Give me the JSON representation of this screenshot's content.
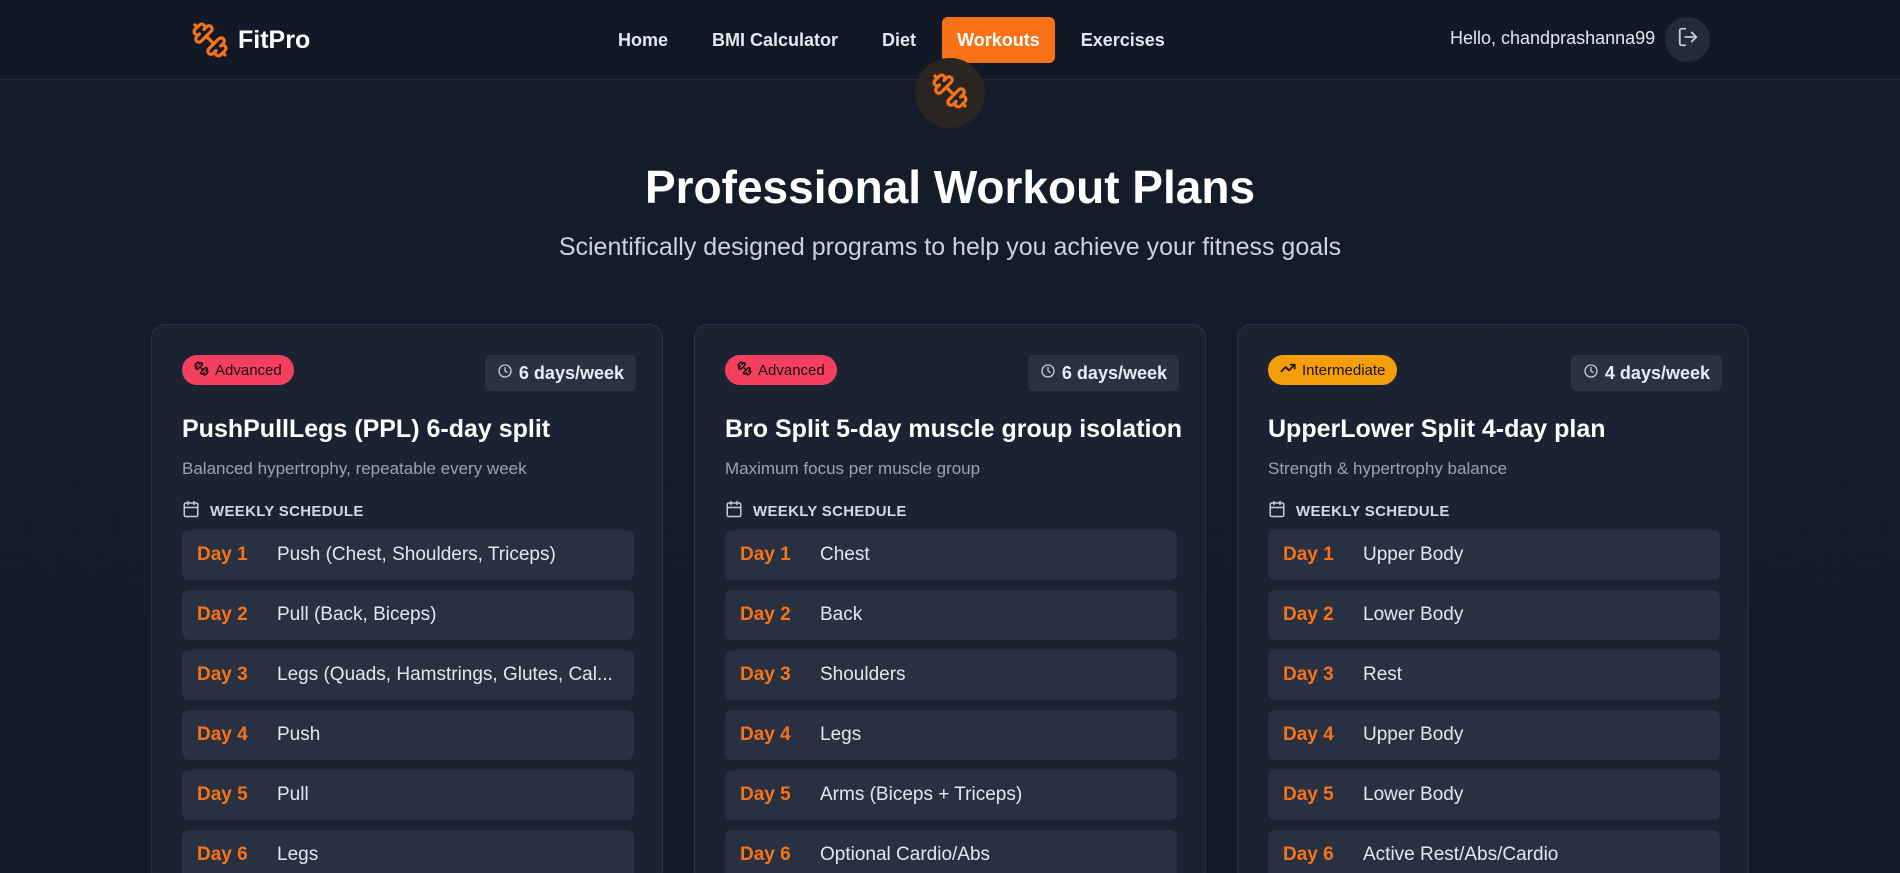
{
  "brand": {
    "name": "FitPro",
    "icon": "dumbbell-icon",
    "accent": "#f97316"
  },
  "nav": {
    "links": [
      {
        "label": "Home",
        "active": false
      },
      {
        "label": "BMI Calculator",
        "active": false
      },
      {
        "label": "Diet",
        "active": false
      },
      {
        "label": "Workouts",
        "active": true
      },
      {
        "label": "Exercises",
        "active": false
      }
    ],
    "greeting": "Hello, chandprashanna99",
    "logout_icon": "logout-icon"
  },
  "hero": {
    "title": "Professional Workout Plans",
    "subtitle": "Scientifically designed programs to help you achieve your fitness goals"
  },
  "plans": [
    {
      "level": "Advanced",
      "level_color": "#f43f5e",
      "frequency": "6 days/week",
      "title": "PushPullLegs (PPL) 6-day split",
      "description": "Balanced hypertrophy, repeatable every week",
      "schedule_label": "WEEKLY SCHEDULE",
      "days": [
        {
          "day": "Day 1",
          "workout": "Push (Chest, Shoulders, Triceps)"
        },
        {
          "day": "Day 2",
          "workout": "Pull (Back, Biceps)"
        },
        {
          "day": "Day 3",
          "workout": "Legs (Quads, Hamstrings, Glutes, Cal..."
        },
        {
          "day": "Day 4",
          "workout": "Push"
        },
        {
          "day": "Day 5",
          "workout": "Pull"
        },
        {
          "day": "Day 6",
          "workout": "Legs"
        }
      ]
    },
    {
      "level": "Advanced",
      "level_color": "#f43f5e",
      "frequency": "6 days/week",
      "title": "Bro Split 5-day muscle group isolation",
      "description": "Maximum focus per muscle group",
      "schedule_label": "WEEKLY SCHEDULE",
      "days": [
        {
          "day": "Day 1",
          "workout": "Chest"
        },
        {
          "day": "Day 2",
          "workout": "Back"
        },
        {
          "day": "Day 3",
          "workout": "Shoulders"
        },
        {
          "day": "Day 4",
          "workout": "Legs"
        },
        {
          "day": "Day 5",
          "workout": "Arms (Biceps + Triceps)"
        },
        {
          "day": "Day 6",
          "workout": "Optional Cardio/Abs"
        }
      ]
    },
    {
      "level": "Intermediate",
      "level_color": "#f59e0b",
      "frequency": "4 days/week",
      "title": "UpperLower Split 4-day plan",
      "description": "Strength & hypertrophy balance",
      "schedule_label": "WEEKLY SCHEDULE",
      "days": [
        {
          "day": "Day 1",
          "workout": "Upper Body"
        },
        {
          "day": "Day 2",
          "workout": "Lower Body"
        },
        {
          "day": "Day 3",
          "workout": "Rest"
        },
        {
          "day": "Day 4",
          "workout": "Upper Body"
        },
        {
          "day": "Day 5",
          "workout": "Lower Body"
        },
        {
          "day": "Day 6",
          "workout": "Active Rest/Abs/Cardio"
        }
      ]
    }
  ]
}
